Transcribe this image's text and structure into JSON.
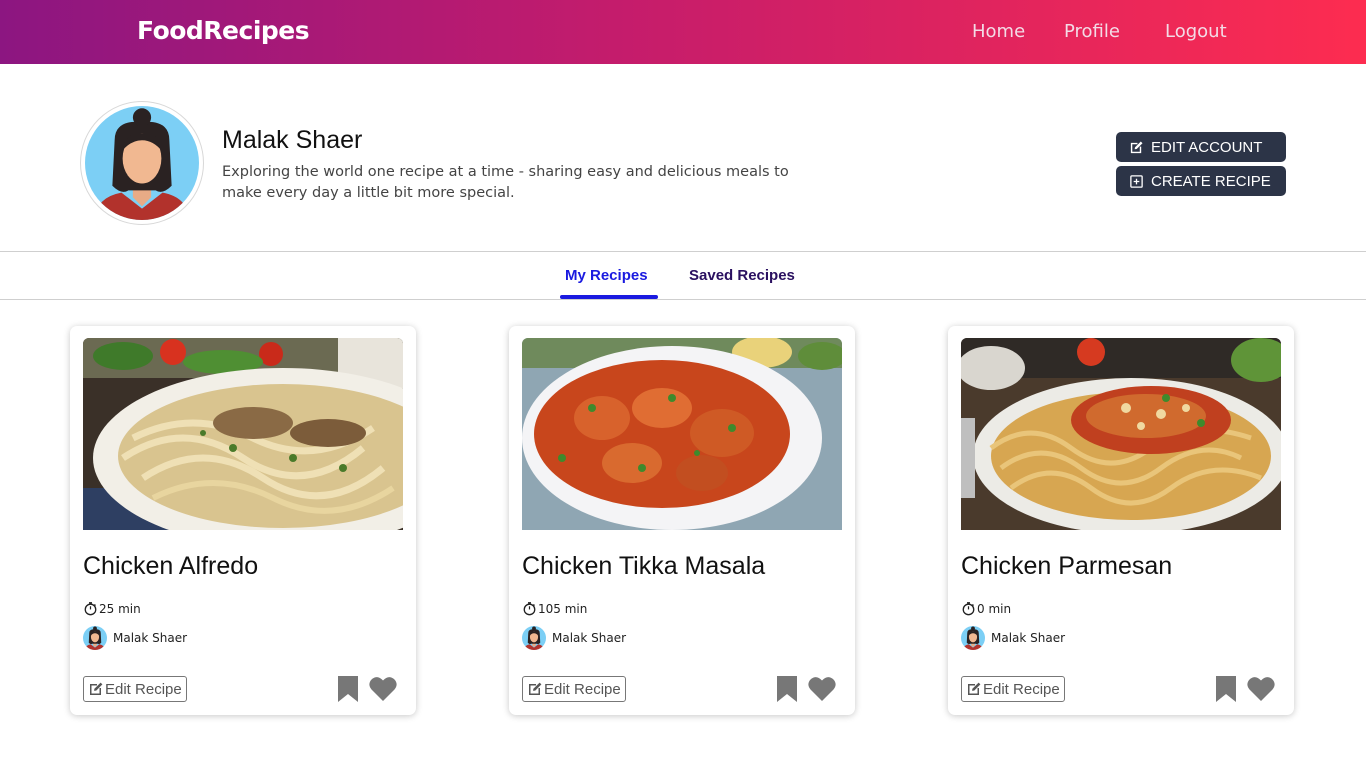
{
  "navbar": {
    "brand": "FoodRecipes",
    "links": [
      "Home",
      "Profile",
      "Logout"
    ]
  },
  "profile": {
    "name": "Malak Shaer",
    "bio": "Exploring the world one recipe at a time - sharing easy and delicious meals to make every day a little bit more special.",
    "edit_account_label": "EDIT ACCOUNT",
    "create_recipe_label": "CREATE RECIPE"
  },
  "tabs": [
    {
      "label": "My Recipes",
      "active": true
    },
    {
      "label": "Saved Recipes",
      "active": false
    }
  ],
  "recipes": [
    {
      "title": "Chicken Alfredo",
      "time": "25 min",
      "author": "Malak Shaer",
      "edit_label": "Edit Recipe"
    },
    {
      "title": "Chicken Tikka Masala",
      "time": "105 min",
      "author": "Malak Shaer",
      "edit_label": "Edit Recipe"
    },
    {
      "title": "Chicken Parmesan",
      "time": "0 min",
      "author": "Malak Shaer",
      "edit_label": "Edit Recipe"
    }
  ],
  "icons": {
    "edit": "edit-icon",
    "create": "plus-square-icon",
    "timer": "stopwatch-icon",
    "bookmark": "bookmark-icon",
    "heart": "heart-icon"
  },
  "colors": {
    "nav_gradient_start": "#8c1681",
    "nav_gradient_end": "#fd2c50",
    "dark_button": "#2c3447",
    "active_tab": "#1a1ae0",
    "inactive_tab": "#2a1060",
    "icon_gray": "#777777"
  }
}
